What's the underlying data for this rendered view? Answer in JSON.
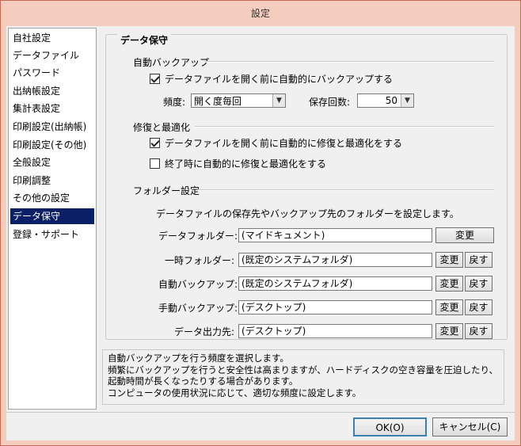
{
  "window": {
    "title": "設定"
  },
  "sidebar": {
    "items": [
      {
        "label": "自社設定"
      },
      {
        "label": "データファイル"
      },
      {
        "label": "パスワード"
      },
      {
        "label": "出納帳設定"
      },
      {
        "label": "集計表設定"
      },
      {
        "label": "印刷設定(出納帳)"
      },
      {
        "label": "印刷設定(その他)"
      },
      {
        "label": "全般設定"
      },
      {
        "label": "印刷調整"
      },
      {
        "label": "その他の設定"
      },
      {
        "label": "データ保守"
      },
      {
        "label": "登録・サポート"
      }
    ],
    "selected": "データ保守"
  },
  "panel": {
    "title": "データ保守",
    "auto_backup": {
      "heading": "自動バックアップ",
      "checkbox_label": "データファイルを開く前に自動的にバックアップする",
      "checked": true,
      "frequency_label": "頻度:",
      "frequency_value": "開く度毎回",
      "count_label": "保存回数:",
      "count_value": "50"
    },
    "repair": {
      "heading": "修復と最適化",
      "option1_label": "データファイルを開く前に自動的に修復と最適化をする",
      "option1_checked": true,
      "option2_label": "終了時に自動的に修復と最適化をする",
      "option2_checked": false
    },
    "folders": {
      "heading": "フォルダー設定",
      "description": "データファイルの保存先やバックアップ先のフォルダーを設定します。",
      "change_label": "変更",
      "reset_label": "戻す",
      "rows": [
        {
          "label": "データフォルダー:",
          "path": "(マイドキュメント)"
        },
        {
          "label": "一時フォルダー:",
          "path": "(既定のシステムフォルダ)"
        },
        {
          "label": "自動バックアップ:",
          "path": "(既定のシステムフォルダ)"
        },
        {
          "label": "手動バックアップ:",
          "path": "(デスクトップ)"
        },
        {
          "label": "データ出力先:",
          "path": "(デスクトップ)"
        }
      ]
    }
  },
  "help": {
    "lines": [
      "自動バックアップを行う頻度を選択します。",
      "頻繁にバックアップを行うと安全性は高まりますが、ハードディスクの空き容量を圧迫したり、",
      "起動時間が長くなったりする場合があります。",
      "コンピュータの使用状況に応じて、適切な頻度に設定します。"
    ]
  },
  "footer": {
    "ok_label": "OK(O)",
    "cancel_label": "キャンセル(C)"
  },
  "colors": {
    "selection": "#0a1f66",
    "frame": "#f5cdbf",
    "ok_border": "#3c7fb1"
  }
}
